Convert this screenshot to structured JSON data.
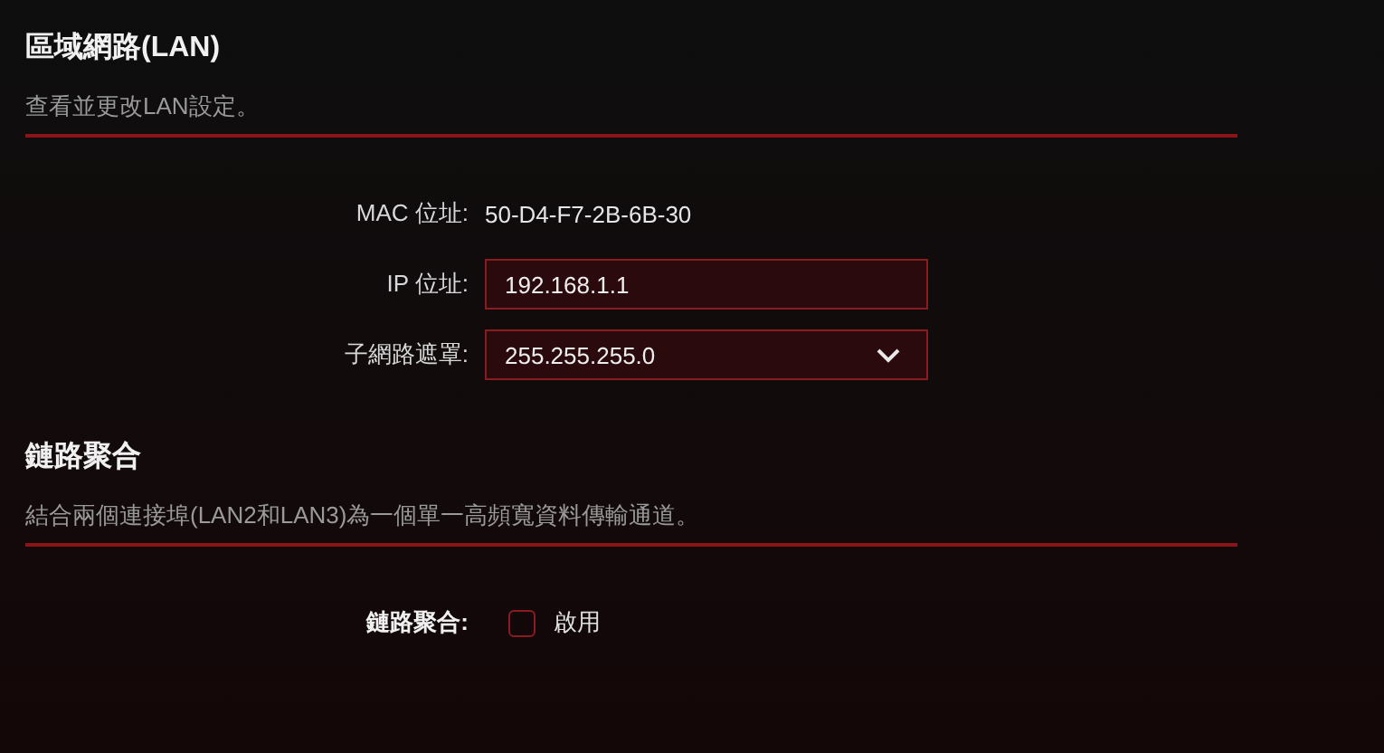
{
  "sections": [
    {
      "title": "區域網路(LAN)",
      "description": "查看並更改LAN設定。",
      "fields": [
        {
          "kind": "text",
          "label": "MAC 位址:",
          "value": "50-D4-F7-2B-6B-30"
        },
        {
          "kind": "input",
          "label": "IP 位址:",
          "value": "192.168.1.1"
        },
        {
          "kind": "select",
          "label": "子網路遮罩:",
          "value": "255.255.255.0"
        }
      ]
    },
    {
      "title": "鏈路聚合",
      "description": "結合兩個連接埠(LAN2和LAN3)為一個單一高頻寬資料傳輸通道。",
      "fields": [
        {
          "kind": "checkbox",
          "label": "鏈路聚合:",
          "option": "啟用",
          "checked": false
        }
      ]
    }
  ]
}
